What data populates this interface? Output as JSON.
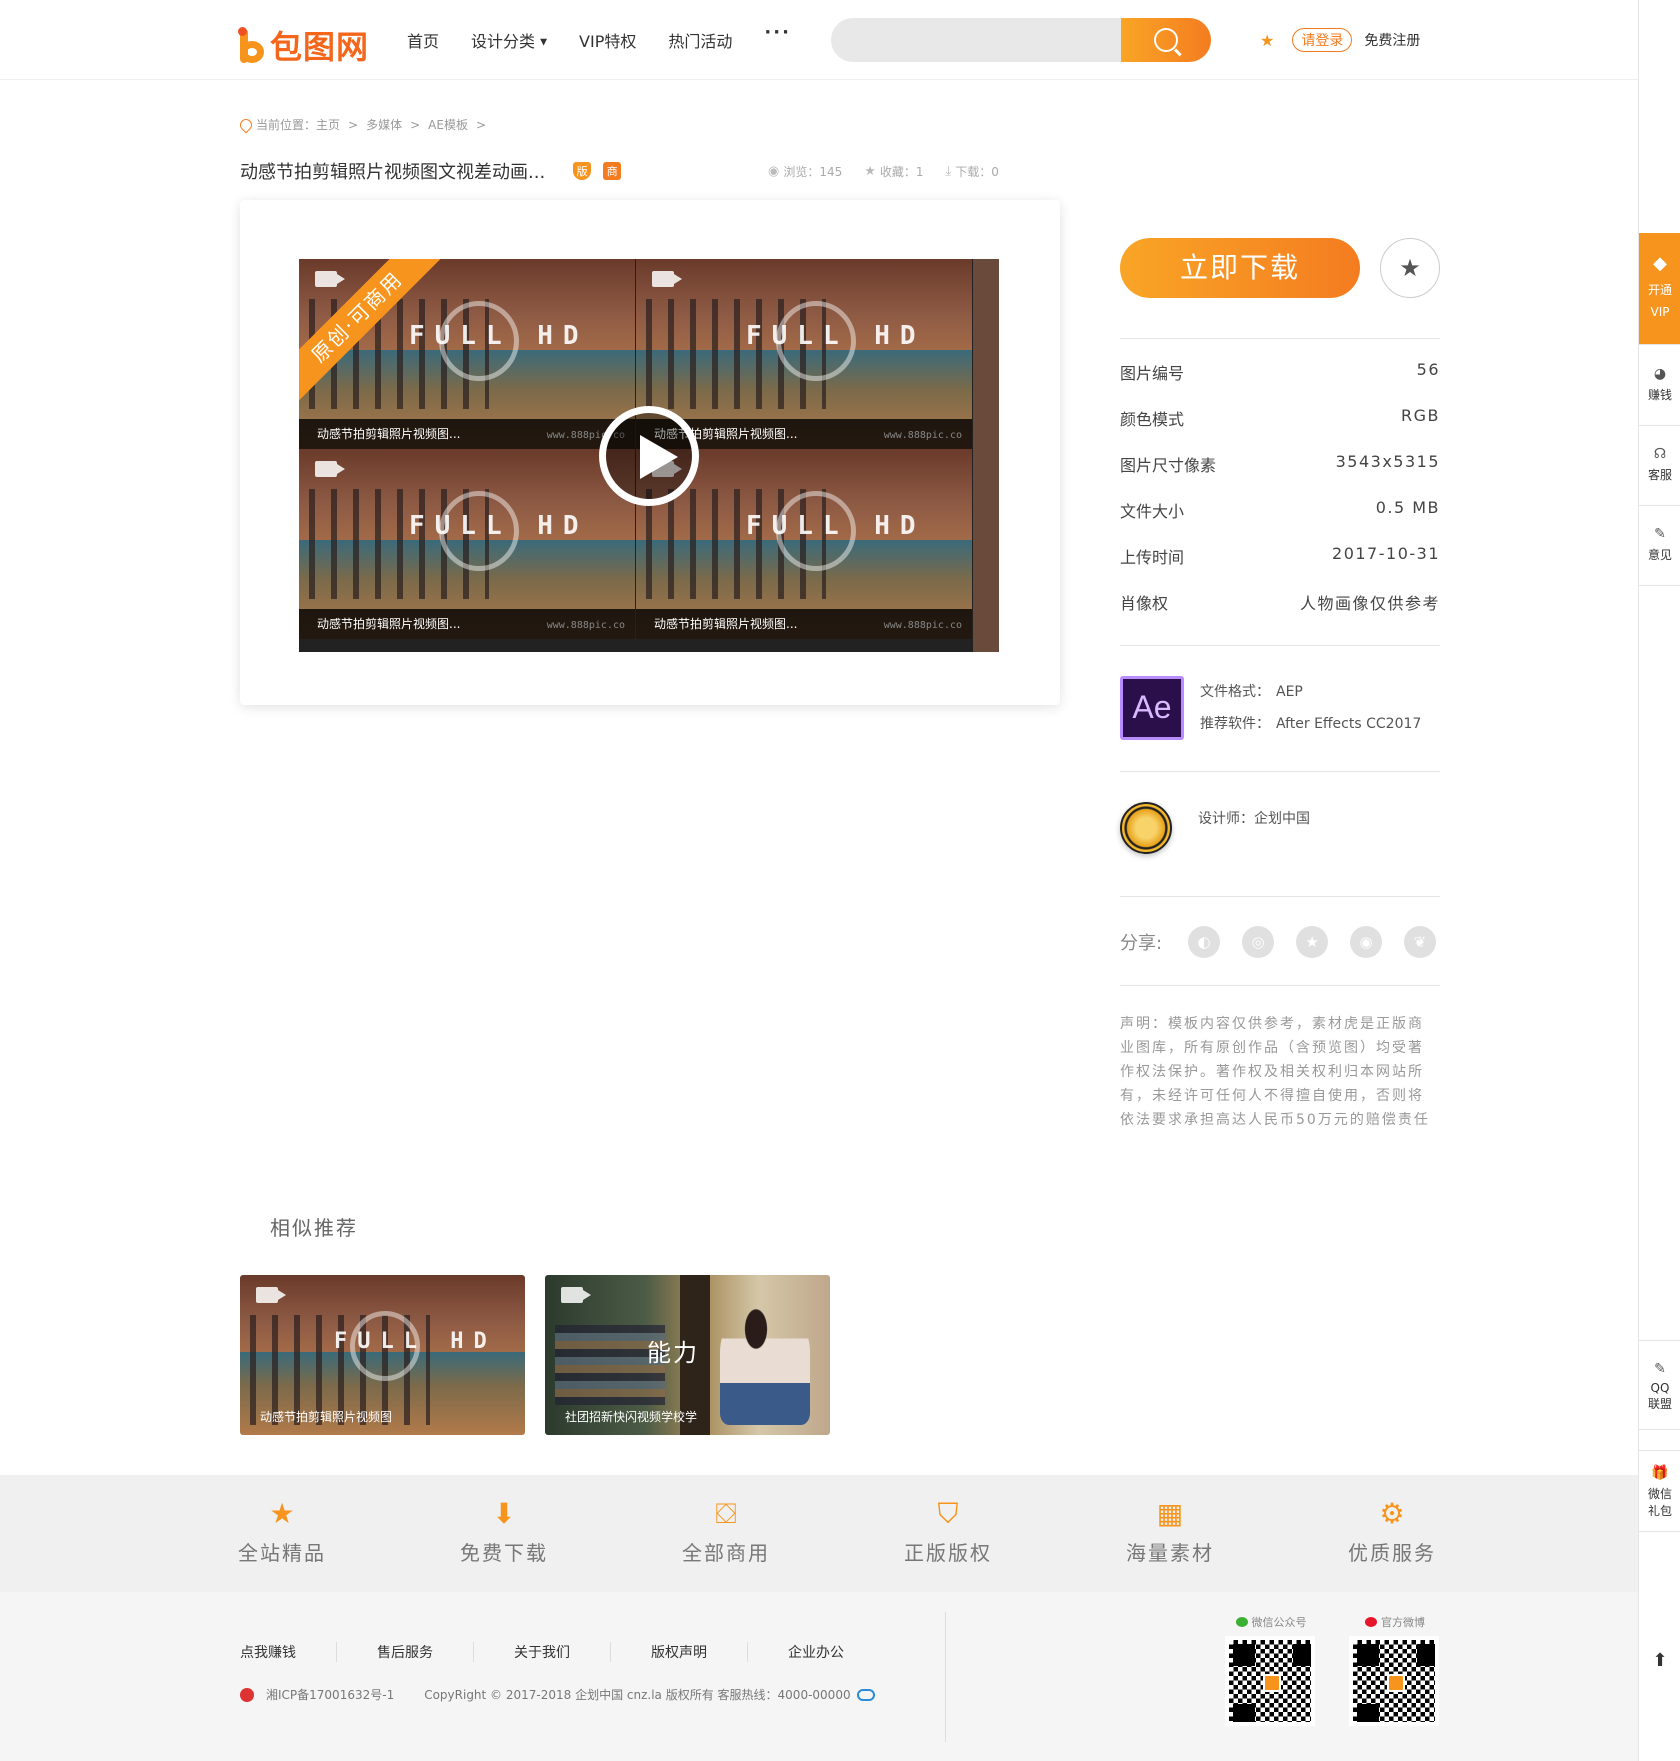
{
  "header": {
    "logo_text": "包图网",
    "nav": [
      {
        "label": "首页"
      },
      {
        "label": "设计分类"
      },
      {
        "label": "VIP特权"
      },
      {
        "label": "热门活动"
      },
      {
        "label": "···"
      }
    ],
    "search": {
      "placeholder": "",
      "value": ""
    },
    "login": "请登录",
    "register": "免费注册"
  },
  "breadcrumb": [
    "当前位置：主页",
    ">",
    "多媒体",
    ">",
    "AE模板",
    ">"
  ],
  "title": "动感节拍剪辑照片视频图文视差动画...",
  "tags": {
    "copyright": "版",
    "commercial": "商"
  },
  "stats": [
    {
      "label": "浏览：145"
    },
    {
      "label": "收藏：1"
    },
    {
      "label": "下载：0"
    }
  ],
  "preview": {
    "ribbon": "原创·可商用",
    "fhd": "FULL HD",
    "watermark": "www.888pic.co",
    "tiles": [
      {
        "caption": "动感节拍剪辑照片视频图..."
      },
      {
        "caption": "动感节拍剪辑照片视频图..."
      },
      {
        "caption": "动感节拍剪辑照片视频图..."
      },
      {
        "caption": "动感节拍剪辑照片视频图..."
      }
    ]
  },
  "download_button": "立即下载",
  "info": [
    {
      "k": "图片编号",
      "v": "56"
    },
    {
      "k": "颜色模式",
      "v": "RGB"
    },
    {
      "k": "图片尺寸像素",
      "v": "3543x5315"
    },
    {
      "k": "文件大小",
      "v": "0.5 MB"
    },
    {
      "k": "上传时间",
      "v": "2017-10-31"
    },
    {
      "k": "肖像权",
      "v": "人物画像仅供参考"
    }
  ],
  "format": {
    "icon_text": "Ae",
    "format_label": "文件格式：",
    "format_value": "AEP",
    "software_label": "推荐软件：",
    "software_value": "After Effects CC2017"
  },
  "designer": "设计师：企划中国",
  "share_label": "分享:",
  "notice": "声明：模板内容仅供参考，素材虎是正版商业图库，所有原创作品（含预览图）均受著作权法保护。著作权及相关权利归本网站所有，未经许可任何人不得擅自使用，否则将依法要求承担高达人民币50万元的赔偿责任",
  "similar": {
    "title": "相似推荐",
    "items": [
      {
        "caption": "动感节拍剪辑照片视频图"
      },
      {
        "caption": "社团招新快闪视频学校学",
        "overlay": "能力"
      }
    ]
  },
  "features": [
    {
      "label": "全站精品",
      "icon": "star-icon"
    },
    {
      "label": "免费下载",
      "icon": "download-icon"
    },
    {
      "label": "全部商用",
      "icon": "bag-icon"
    },
    {
      "label": "正版版权",
      "icon": "shield-icon"
    },
    {
      "label": "海量素材",
      "icon": "grid-icon"
    },
    {
      "label": "优质服务",
      "icon": "gear-icon"
    }
  ],
  "footer": {
    "links": [
      "点我赚钱",
      "售后服务",
      "关于我们",
      "版权声明",
      "企业办公"
    ],
    "icp": "湘ICP备17001632号-1",
    "copyright": "CopyRight © 2017-2018 企划中国 cnz.la 版权所有 客服热线：4000-00000",
    "wechat_label": "微信公众号",
    "weibo_label": "官方微博"
  },
  "sidebar": [
    {
      "label": "开通VIP",
      "icon": "diamond-icon"
    },
    {
      "label": "赚钱",
      "icon": "coin-icon"
    },
    {
      "label": "客服",
      "icon": "headset-icon"
    },
    {
      "label": "意见",
      "icon": "edit-icon"
    },
    {
      "label": "QQ联盟",
      "icon": "qq-icon"
    },
    {
      "label": "微信礼包",
      "icon": "gift-icon"
    }
  ],
  "colors": {
    "accent": "#f7941d",
    "accent_dark": "#f47c20"
  }
}
